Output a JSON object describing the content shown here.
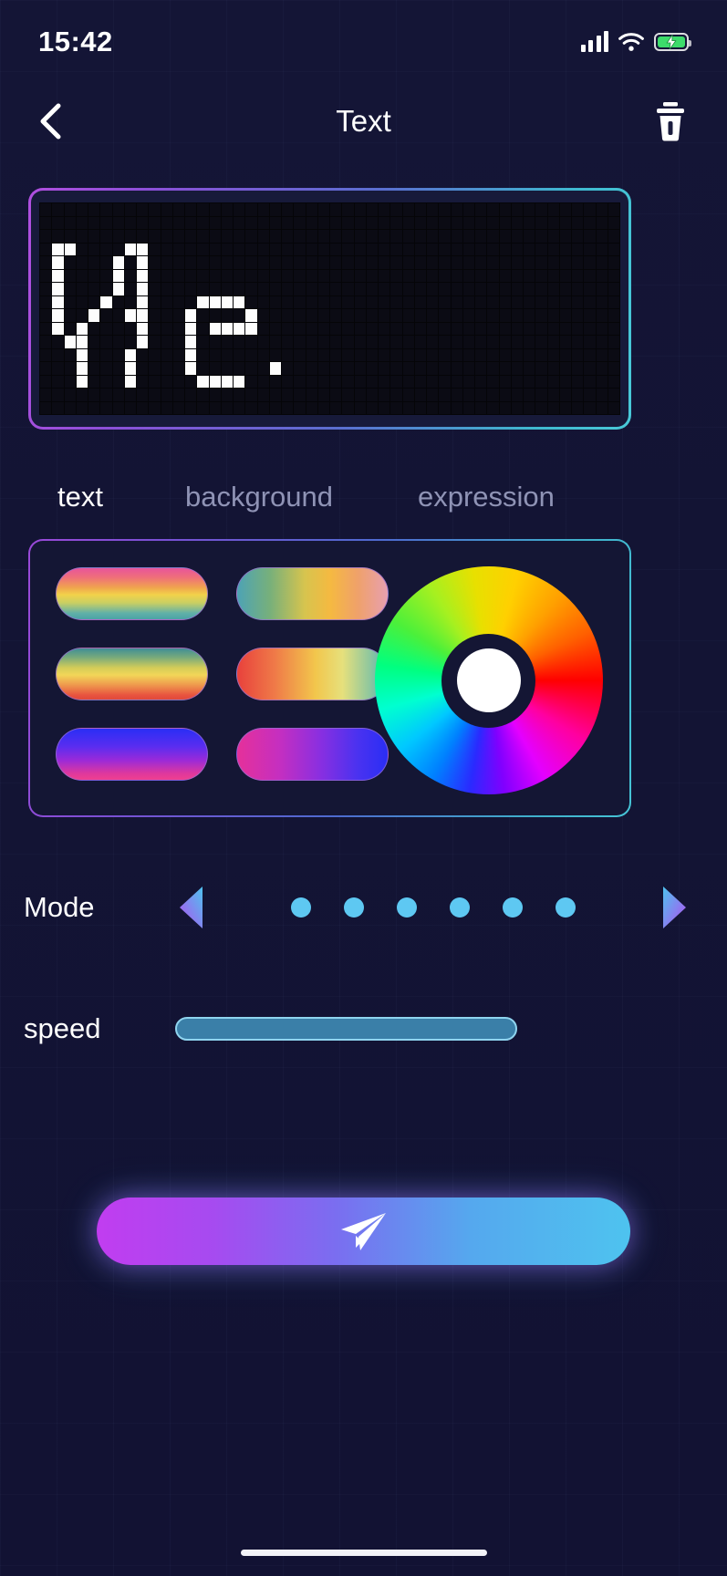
{
  "status_bar": {
    "time": "15:42",
    "signal_icon": "cellular-signal-icon",
    "wifi_icon": "wifi-icon",
    "battery_icon": "battery-charging-icon",
    "battery_color": "#3ddc6b"
  },
  "header": {
    "back_icon": "chevron-left-icon",
    "title": "Text",
    "delete_icon": "trash-icon"
  },
  "led_display": {
    "name": "led-matrix-preview",
    "text": "We",
    "columns": 48,
    "rows": 16,
    "pixel_on_color": "#fdfdfd",
    "pixel_off_color": "#0b0b14",
    "border_gradient_from": "#b14fe0",
    "border_gradient_to": "#49c9d8",
    "pixels": [
      "000000000000000000000000000000000000000000000000",
      "000000000000000000000000000000000000000000000000",
      "000000000000000000000000000000000000000000000000",
      "011000011000000000000000000000000000000000000000",
      "010000101000000000000000000000000000000000000000",
      "010000101000000000000000000000000000000000000000",
      "010000101000000000000000000000000000000000000000",
      "010001001000011110000000000000000000000000000000",
      "010010011000100001000000000000000000000000000000",
      "010100001000101111000000000000000000000000000000",
      "001100001000100000000000000000000000000000000000",
      "000100010000100000000000000000000000000000000000",
      "000100010000100000010000000000000000000000000000",
      "000100010000011110000000000000000000000000000000",
      "000000000000000000000000000000000000000000000000",
      "000000000000000000000000000000000000000000000000"
    ]
  },
  "tabs": [
    {
      "label": "text",
      "active": true
    },
    {
      "label": "background",
      "active": false
    },
    {
      "label": "expression",
      "active": false
    }
  ],
  "color_panel": {
    "name": "color-selection-panel",
    "swatches": [
      {
        "name": "gradient-swatch-1",
        "css": "linear-gradient(180deg,#e8559a 0%,#ef6f7a 18%,#f0a44e 38%,#f2d24a 52%,#c9cf63 68%,#61b0a8 88%,#4aa3a6 100%)"
      },
      {
        "name": "gradient-swatch-2",
        "css": "linear-gradient(90deg,#4da3b5 0%,#78b07a 22%,#d7c44e 45%,#f5b941 62%,#efa16a 80%,#e8a0b0 100%)"
      },
      {
        "name": "gradient-swatch-3",
        "css": "linear-gradient(180deg,#3f8e96 0%,#7aab7a 18%,#d4cc58 38%,#f2d658 52%,#ef9e4e 70%,#e8523f 92%,#e04a3a 100%)"
      },
      {
        "name": "gradient-swatch-4",
        "css": "linear-gradient(90deg,#e8413c 0%,#ef7a48 25%,#f2c64c 52%,#e6e07c 70%,#8fc79e 88%,#53afb8 100%)"
      },
      {
        "name": "gradient-swatch-5",
        "css": "linear-gradient(180deg,#2a2ef5 0%,#5a2df0 35%,#9b2ad8 62%,#e0389c 88%,#ef3f8f 100%)"
      },
      {
        "name": "gradient-swatch-6",
        "css": "linear-gradient(90deg,#e5309a 0%,#c52fc0 28%,#8a2fe0 55%,#4a32f0 80%,#2a2ef5 100%)"
      }
    ],
    "color_wheel": {
      "name": "color-wheel-picker",
      "selected_color": "#ffffff"
    }
  },
  "mode": {
    "label": "Mode",
    "prev_icon": "triangle-left-icon",
    "next_icon": "triangle-right-icon",
    "dot_count": 6,
    "dot_color": "#5ec8f2",
    "arrow_gradient_from": "#4ec3ef",
    "arrow_gradient_to": "#b34ef0"
  },
  "speed": {
    "label": "speed",
    "value": 100,
    "track_color": "#3a7fa8",
    "outline_color": "#8fd4ef"
  },
  "send_button": {
    "name": "send-button",
    "icon": "paper-plane-icon",
    "gradient_from": "#c13df0",
    "gradient_to": "#4ec3ef"
  },
  "home_indicator": "home-indicator"
}
